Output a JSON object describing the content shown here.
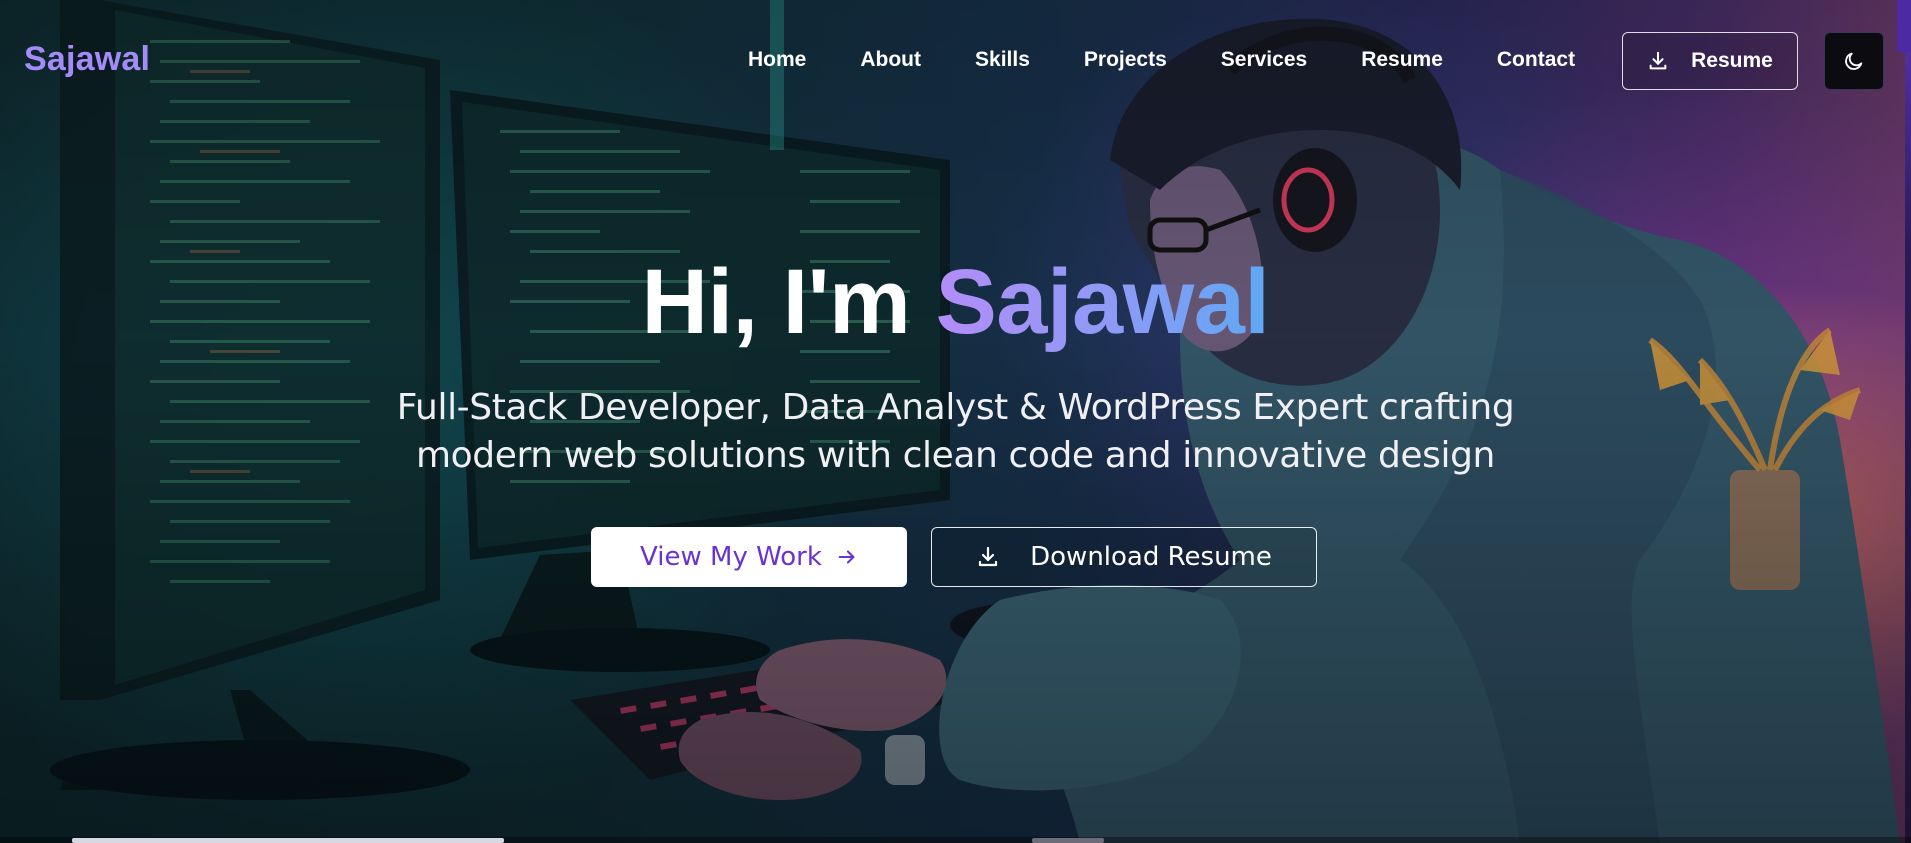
{
  "brand": {
    "logo_text": "Sajawal",
    "accent_color": "#a58bf7"
  },
  "nav": {
    "links": [
      "Home",
      "About",
      "Skills",
      "Projects",
      "Services",
      "Resume",
      "Contact"
    ],
    "resume_button_label": "Resume",
    "resume_button_icon": "download-icon",
    "theme_toggle_icon": "moon-icon"
  },
  "hero": {
    "greeting": "Hi, I'm",
    "name": "Sajawal",
    "subtitle_line1": "Full-Stack Developer, Data Analyst & WordPress Expert crafting",
    "subtitle_line2": "modern web solutions with clean code and innovative design",
    "primary_button_label": "View My Work",
    "primary_button_icon": "arrow-right-icon",
    "secondary_button_label": "Download Resume",
    "secondary_button_icon": "download-icon",
    "name_gradient": [
      "#b48cf7",
      "#5fa8f4"
    ]
  }
}
